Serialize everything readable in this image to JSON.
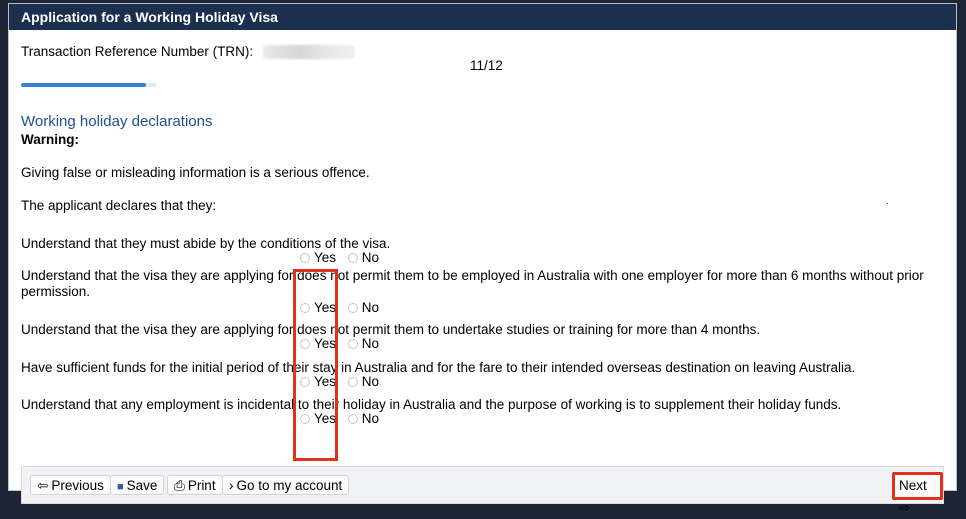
{
  "window": {
    "title": "Application for a Working Holiday Visa"
  },
  "header": {
    "trn_label": "Transaction Reference Number (TRN):",
    "page_indicator": "11/12",
    "progress": 0.917
  },
  "section": {
    "title": "Working holiday declarations",
    "warning_label": "Warning:",
    "warning_text": "Giving false or misleading information is a serious offence.",
    "intro": "The applicant declares that they:",
    "stray_mark": "."
  },
  "questions": [
    {
      "text": "Understand that they must abide by the conditions of the visa."
    },
    {
      "text": "Understand that the visa they are applying for does not permit them to be employed in Australia with one employer for more than 6 months without prior permission."
    },
    {
      "text": "Understand that the visa they are applying for does not permit them to undertake studies or training for more than 4 months."
    },
    {
      "text": "Have sufficient funds for the initial period of their stay in Australia and for the fare to their intended overseas destination on leaving Australia."
    },
    {
      "text": "Understand that any employment is incidental to their holiday in Australia and the purpose of working is to supplement their holiday funds."
    }
  ],
  "options": {
    "yes": "Yes",
    "no": "No"
  },
  "footer": {
    "previous": "Previous",
    "save": "Save",
    "print": "Print",
    "account": "Go to my account",
    "next": "Next"
  },
  "icons": {
    "previous": "arrow-left-icon",
    "save": "floppy-disk-icon",
    "print": "printer-icon",
    "account": "chevron-right-icon",
    "next": "arrow-right-icon"
  },
  "colors": {
    "titlebar": "#1b2f4e",
    "section_title": "#1f4d99",
    "progress": "#3a7fd6",
    "highlight": "#e0301e"
  }
}
